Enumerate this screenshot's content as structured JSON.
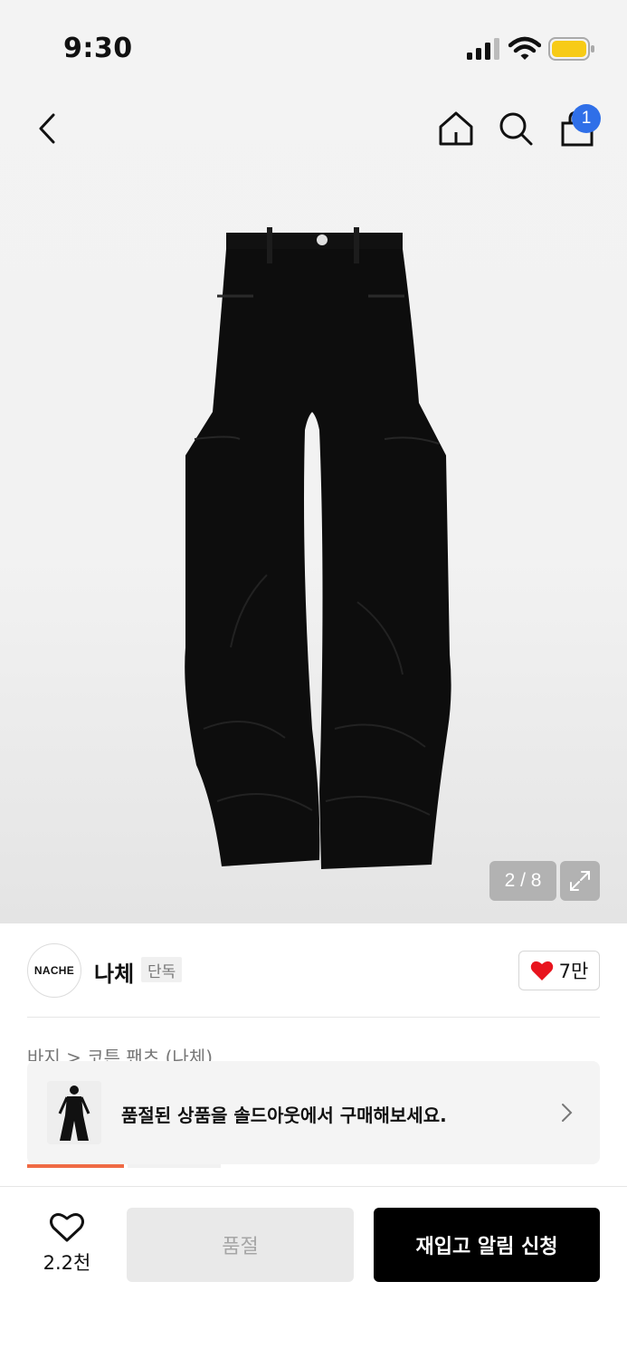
{
  "status_bar": {
    "time": "9:30"
  },
  "header": {
    "cart_count": "1",
    "icons": [
      "back-icon",
      "home-icon",
      "search-icon",
      "shopping-bag-icon"
    ]
  },
  "gallery": {
    "pager": "2 / 8",
    "current": 2,
    "total": 8
  },
  "brand": {
    "logo_text": "NACHE",
    "name": "나체",
    "tag": "단독",
    "likes": "7만",
    "heart_color": "#e8141e"
  },
  "breadcrumb": "바지 > 코튼 팬츠 (나체)",
  "soldout_banner": {
    "text": "품절된 상품을 솔드아웃에서 구매해보세요."
  },
  "bottom_bar": {
    "wish_count": "2.2천",
    "soldout_label": "품절",
    "restock_label": "재입고 알림 신청"
  },
  "colors": {
    "accent": "#ef6a44",
    "badge": "#2f6fe8",
    "battery": "#f7cb16"
  }
}
